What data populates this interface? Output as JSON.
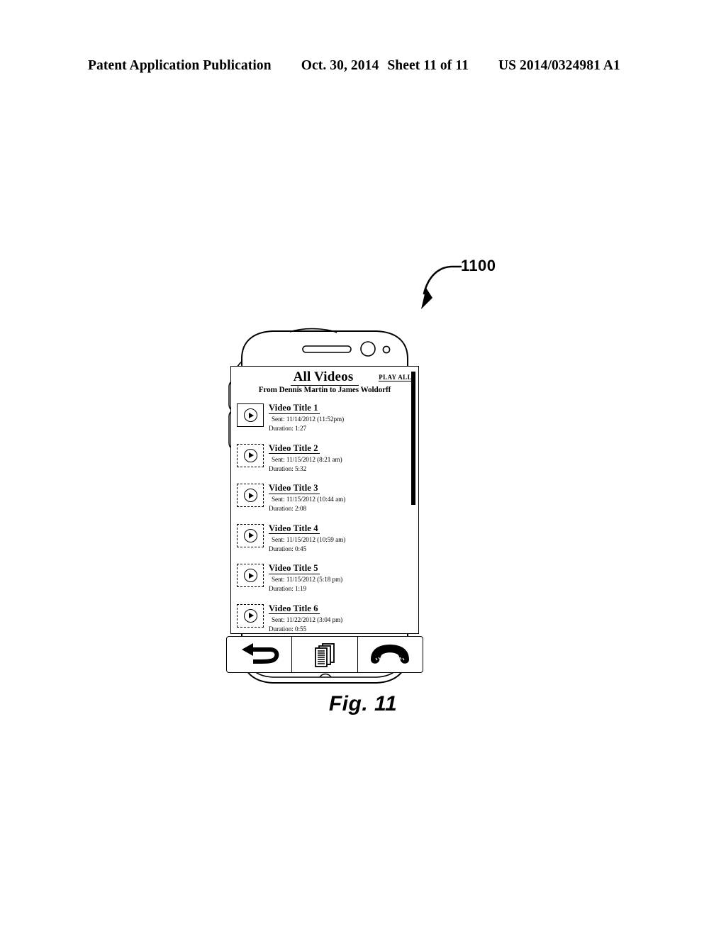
{
  "header": {
    "left": "Patent Application Publication",
    "date": "Oct. 30, 2014",
    "sheet": "Sheet 11 of 11",
    "patent_number": "US 2014/0324981 A1"
  },
  "figure": {
    "reference_numeral": "1100",
    "caption": "Fig. 11"
  },
  "screen": {
    "title": "All Videos",
    "play_all_label": "PLAY ALL",
    "subtitle": "From Dennis Martin to James Woldorff",
    "videos": [
      {
        "title": "Video Title 1",
        "sent": "Sent: 11/14/2012 (11:52pm)",
        "duration": "Duration: 1:27",
        "thumb_icon": "play-icon"
      },
      {
        "title": "Video Title 2",
        "sent": "Sent: 11/15/2012 (8:21 am)",
        "duration": "Duration: 5:32",
        "thumb_icon": "play-icon"
      },
      {
        "title": "Video Title 3",
        "sent": "Sent: 11/15/2012 (10:44 am)",
        "duration": "Duration: 2:08",
        "thumb_icon": "play-icon"
      },
      {
        "title": "Video Title 4",
        "sent": "Sent: 11/15/2012 (10:59 am)",
        "duration": "Duration: 0:45",
        "thumb_icon": "play-icon"
      },
      {
        "title": "Video Title 5",
        "sent": "Sent: 11/15/2012 (5:18 pm)",
        "duration": "Duration: 1:19",
        "thumb_icon": "play-icon"
      },
      {
        "title": "Video Title 6",
        "sent": "Sent: 11/22/2012 (3:04 pm)",
        "duration": "Duration: 0:55",
        "thumb_icon": "play-icon"
      }
    ]
  },
  "nav": {
    "buttons": [
      {
        "name": "back-button",
        "icon": "back-arrow-icon"
      },
      {
        "name": "documents-button",
        "icon": "documents-icon"
      },
      {
        "name": "end-call-button",
        "icon": "phone-handset-icon"
      }
    ]
  },
  "hardware": {
    "earpiece": "speaker-slot",
    "camera": "front-camera",
    "sensor": "proximity-sensor",
    "volume_buttons": 2
  },
  "colors": {
    "ink": "#000000",
    "paper": "#ffffff"
  }
}
